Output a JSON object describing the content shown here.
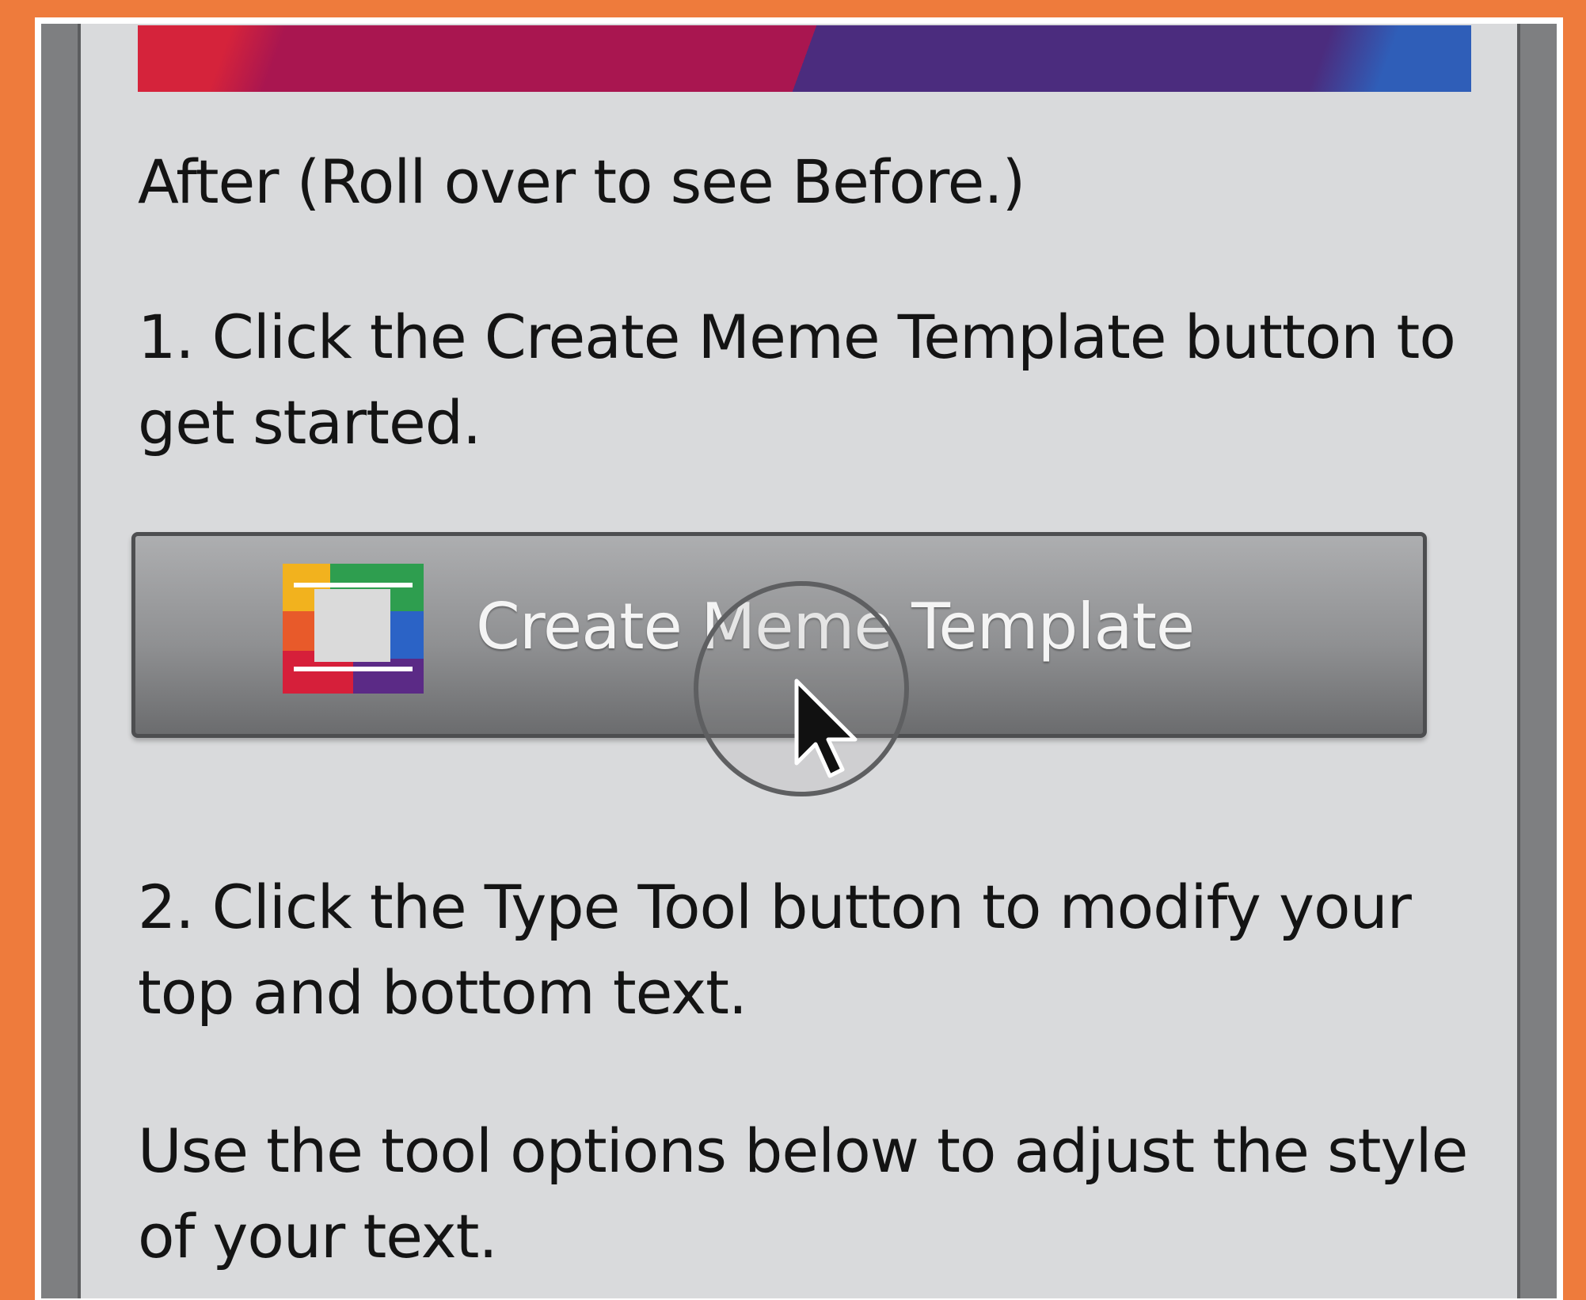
{
  "panel": {
    "after_label": "After (Roll over to see Before.)",
    "step1": "1. Click the Create Meme Template button to get started.",
    "create_button": {
      "label": "Create Meme Template",
      "icon": "meme-template-icon"
    },
    "step2": "2. Click the Type Tool button to modify your top and bottom text.",
    "step3": "Use the tool options below to adjust the style of your text."
  },
  "colors": {
    "background": "#EE7B3C",
    "panel": "#D9DADC",
    "panel_border": "#7E7F81",
    "bar_red": "#D5233B",
    "bar_magenta": "#A91650",
    "bar_purple": "#4B2C7E",
    "bar_blue": "#2F5EB8"
  },
  "cursor": "pointer-cursor-icon"
}
